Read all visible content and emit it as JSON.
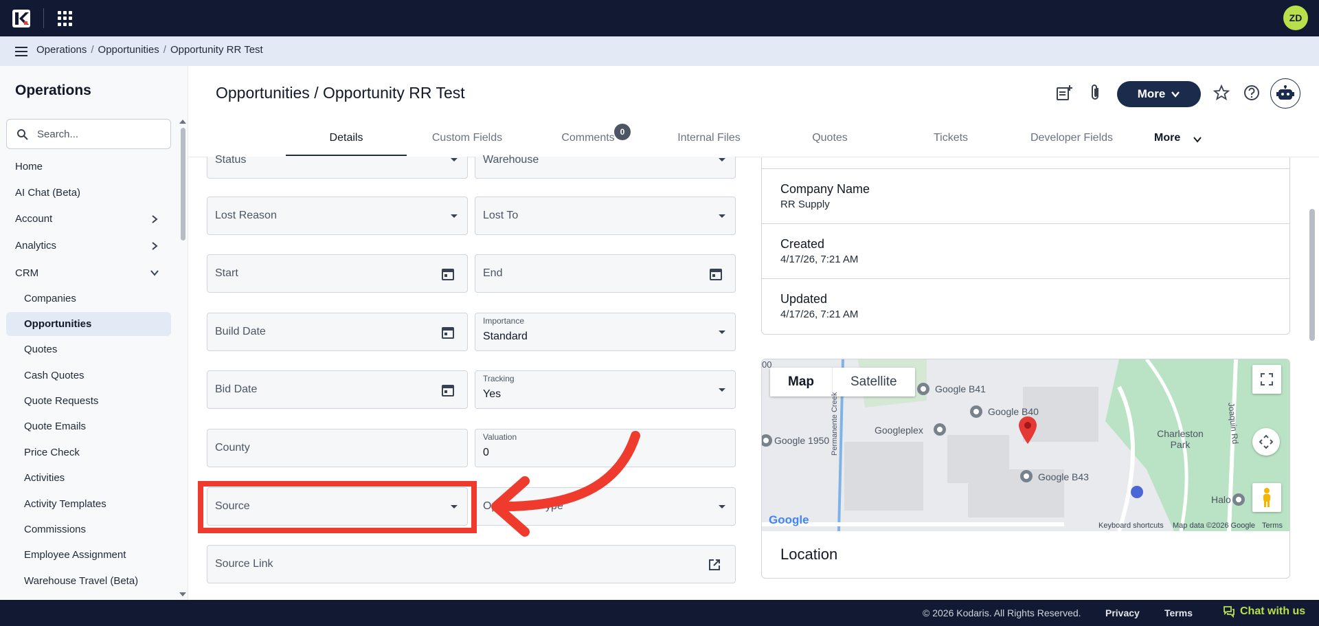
{
  "header": {
    "avatar_initials": "ZD"
  },
  "breadcrumb": [
    "Operations",
    "Opportunities",
    "Opportunity RR Test"
  ],
  "sidebar": {
    "title": "Operations",
    "search_placeholder": "Search...",
    "items": [
      {
        "label": "Home"
      },
      {
        "label": "AI Chat (Beta)"
      },
      {
        "label": "Account"
      },
      {
        "label": "Analytics"
      },
      {
        "label": "CRM"
      }
    ],
    "crm_items": [
      {
        "label": "Companies"
      },
      {
        "label": "Opportunities"
      },
      {
        "label": "Quotes"
      },
      {
        "label": "Cash Quotes"
      },
      {
        "label": "Quote Requests"
      },
      {
        "label": "Quote Emails"
      },
      {
        "label": "Price Check"
      },
      {
        "label": "Activities"
      },
      {
        "label": "Activity Templates"
      },
      {
        "label": "Commissions"
      },
      {
        "label": "Employee Assignment"
      },
      {
        "label": "Warehouse Travel (Beta)"
      }
    ]
  },
  "page": {
    "title": "Opportunities / Opportunity RR Test",
    "more_label": "More"
  },
  "tabs": {
    "items": [
      "Details",
      "Custom Fields",
      "Comments",
      "Internal Files",
      "Quotes",
      "Tickets",
      "Developer Fields"
    ],
    "comments_badge": "0",
    "more_label": "More"
  },
  "form": {
    "status": "Status",
    "warehouse": "Warehouse",
    "lost_reason": "Lost Reason",
    "lost_to": "Lost To",
    "start": "Start",
    "end": "End",
    "build_date": "Build Date",
    "importance_label": "Importance",
    "importance_value": "Standard",
    "bid_date": "Bid Date",
    "tracking_label": "Tracking",
    "tracking_value": "Yes",
    "county": "County",
    "valuation_label": "Valuation",
    "valuation_value": "0",
    "source": "Source",
    "opp_type_visible": "Op",
    "opp_type_visible_tail": "ype",
    "source_link": "Source Link"
  },
  "info": {
    "company_label": "Company Name",
    "company_value": "RR Supply",
    "created_label": "Created",
    "created_value": "4/17/26, 7:21 AM",
    "updated_label": "Updated",
    "updated_value": "4/17/26, 7:21 AM"
  },
  "map": {
    "tab_map": "Map",
    "tab_satellite": "Satellite",
    "labels": [
      "Google B41",
      "Google B40",
      "Googleplex",
      "Google 1950",
      "Google B43",
      "Charleston Park",
      "Halo",
      "Permanente Creek",
      "Joaquin Rd",
      "00"
    ],
    "keyboard": "Keyboard shortcuts",
    "mapdata": "Map data ©2026 Google",
    "terms": "Terms",
    "google_logo": "Google",
    "location_title": "Location"
  },
  "footer": {
    "copyright": "© 2026 Kodaris. All Rights Reserved.",
    "privacy": "Privacy",
    "terms": "Terms",
    "chat": "Chat with us"
  },
  "colors": {
    "topbar": "#121a33",
    "accent": "#1a2b4c",
    "avatar": "#b7e04a",
    "annotation": "#ef3b2d",
    "pin": "#e53935"
  }
}
